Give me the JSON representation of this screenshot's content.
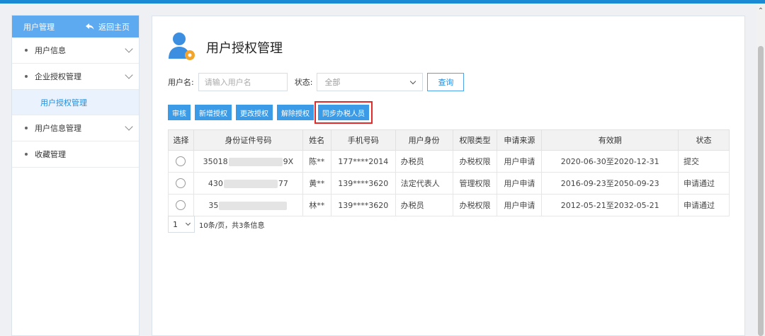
{
  "sidebar": {
    "header": {
      "title": "用户管理",
      "back_label": "返回主页"
    },
    "items": [
      {
        "label": "用户信息",
        "expandable": true
      },
      {
        "label": "企业授权管理",
        "expandable": true,
        "children": [
          {
            "label": "用户授权管理",
            "active": true
          }
        ]
      },
      {
        "label": "用户信息管理",
        "expandable": true
      },
      {
        "label": "收藏管理",
        "expandable": false
      }
    ]
  },
  "page": {
    "title": "用户授权管理"
  },
  "filter": {
    "username_label": "用户名:",
    "username_placeholder": "请输入用户名",
    "status_label": "状态:",
    "status_value": "全部",
    "query_label": "查询"
  },
  "actions": [
    {
      "label": "审核"
    },
    {
      "label": "新增授权"
    },
    {
      "label": "更改授权"
    },
    {
      "label": "解除授权"
    },
    {
      "label": "同步办税人员",
      "highlighted": true
    }
  ],
  "table": {
    "columns": [
      "选择",
      "身份证件号码",
      "姓名",
      "手机号码",
      "用户身份",
      "权限类型",
      "申请来源",
      "有效期",
      "状态"
    ],
    "rows": [
      {
        "id_prefix": "35018",
        "id_suffix": "9X",
        "name": "陈**",
        "phone": "177****2014",
        "role": "办税员",
        "perm": "办税权限",
        "source": "用户申请",
        "validity": "2020-06-30至2020-12-31",
        "status": "提交"
      },
      {
        "id_prefix": "430",
        "id_suffix": "77",
        "name": "黄**",
        "phone": "139****3620",
        "role": "法定代表人",
        "perm": "管理权限",
        "source": "用户申请",
        "validity": "2016-09-23至2050-09-23",
        "status": "申请通过"
      },
      {
        "id_prefix": "35",
        "id_suffix": "",
        "name": "林**",
        "phone": "139****3620",
        "role": "办税员",
        "perm": "办税权限",
        "source": "用户申请",
        "validity": "2012-05-21至2032-05-21",
        "status": "申请通过"
      }
    ]
  },
  "pager": {
    "page": "1",
    "info": "10条/页，共3条信息"
  },
  "colors": {
    "accent": "#3c9be6",
    "sidebar_header": "#5eaaf0",
    "highlight_border": "#e22a2a",
    "topbar": "#1a8ad4"
  }
}
